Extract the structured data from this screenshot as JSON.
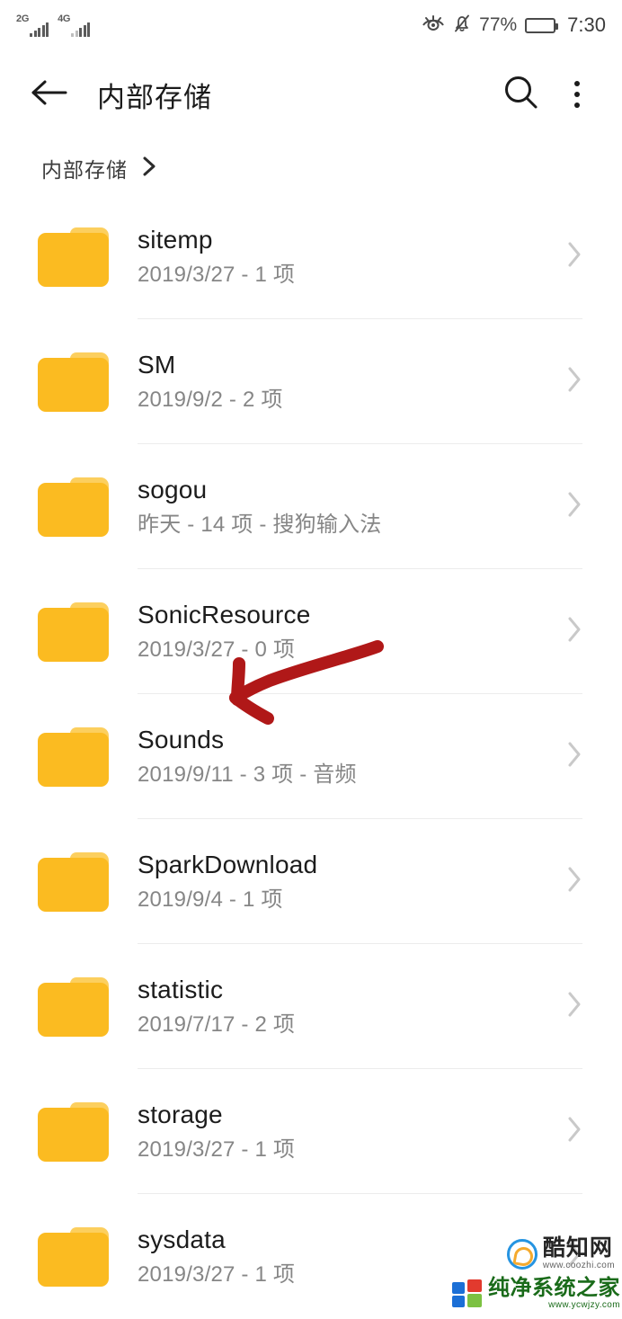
{
  "status_bar": {
    "signal_1": "2G",
    "signal_2": "4G",
    "eye_comfort_icon": "eye-icon",
    "silent_icon": "bell-muted-icon",
    "battery_percent": "77%",
    "time": "7:30"
  },
  "app_bar": {
    "back_icon": "back-arrow-icon",
    "title": "内部存储",
    "search_icon": "search-icon",
    "overflow_icon": "more-vertical-icon"
  },
  "breadcrumb": {
    "label": "内部存储",
    "chevron_icon": "chevron-right-icon"
  },
  "file_list": [
    {
      "name": "sitemp",
      "meta": "2019/3/27 - 1 项"
    },
    {
      "name": "SM",
      "meta": "2019/9/2 - 2 项"
    },
    {
      "name": "sogou",
      "meta": "昨天 - 14 项 - 搜狗输入法"
    },
    {
      "name": "SonicResource",
      "meta": "2019/3/27 - 0 项"
    },
    {
      "name": "Sounds",
      "meta": "2019/9/11 - 3 项 - 音频"
    },
    {
      "name": "SparkDownload",
      "meta": "2019/9/4 - 1 项"
    },
    {
      "name": "statistic",
      "meta": "2019/7/17 - 2 项"
    },
    {
      "name": "storage",
      "meta": "2019/3/27 - 1 项"
    },
    {
      "name": "sysdata",
      "meta": "2019/3/27 - 1 项"
    }
  ],
  "annotation": {
    "type": "arrow",
    "color": "#B01818",
    "points_to": "Sounds"
  },
  "watermarks": [
    {
      "name": "酷知网",
      "url": "www.coozhi.com"
    },
    {
      "name": "纯净系统之家",
      "url": "www.ycwjzy.com"
    }
  ],
  "colors": {
    "folder": "#FBBB21",
    "folder_tab": "#FCCF5E",
    "title_text": "#1c1c1c",
    "meta_text": "#868686",
    "divider": "#ececec",
    "annotation": "#B01818"
  }
}
